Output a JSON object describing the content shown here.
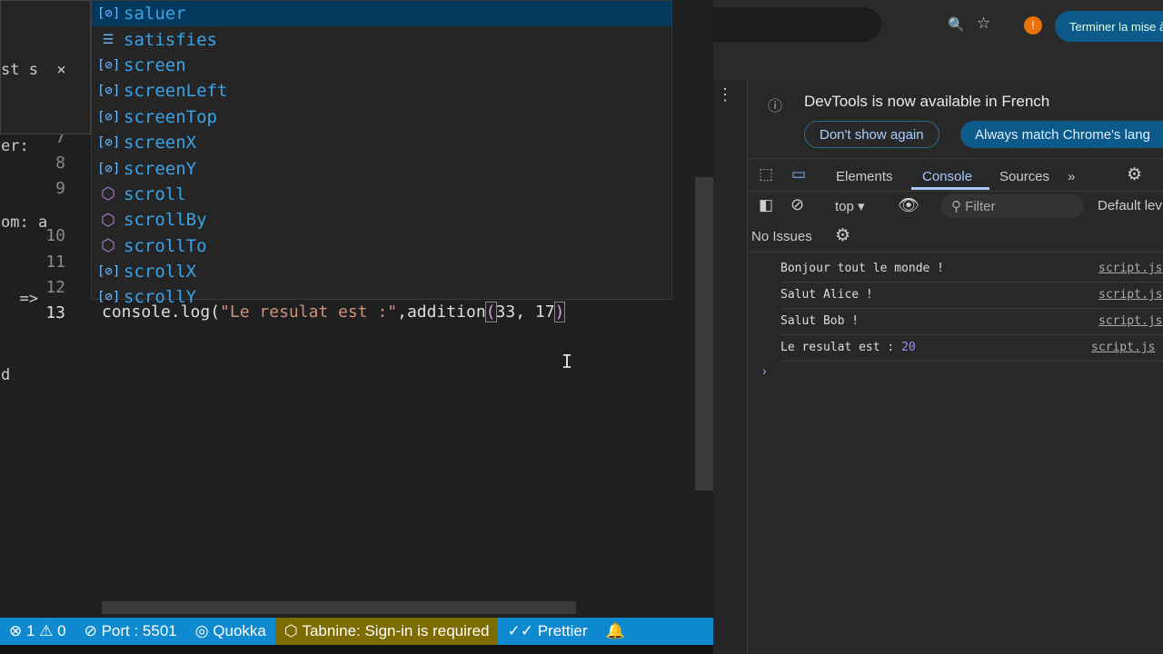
{
  "editor": {
    "tooltip_lines": [
      "st s  ×",
      "er:",
      "om: a",
      "  =>",
      "d"
    ],
    "line_numbers": [
      "7",
      "8",
      "9",
      "10",
      "11",
      "12",
      "13"
    ],
    "code": {
      "prefix": "console.log(",
      "string": "\"Le resulat est :\"",
      "mid": ",addition",
      "open": "(",
      "args": "33, 17",
      "close": ")"
    },
    "suggestions": [
      {
        "icon": "variable-icon",
        "label": "saluer"
      },
      {
        "icon": "keyword-icon",
        "label": "satisfies"
      },
      {
        "icon": "variable-icon",
        "label": "screen"
      },
      {
        "icon": "variable-icon",
        "label": "screenLeft"
      },
      {
        "icon": "variable-icon",
        "label": "screenTop"
      },
      {
        "icon": "variable-icon",
        "label": "screenX"
      },
      {
        "icon": "variable-icon",
        "label": "screenY"
      },
      {
        "icon": "method-icon",
        "label": "scroll"
      },
      {
        "icon": "method-icon",
        "label": "scrollBy"
      },
      {
        "icon": "method-icon",
        "label": "scrollTo"
      },
      {
        "icon": "variable-icon",
        "label": "scrollX"
      },
      {
        "icon": "variable-icon",
        "label": "scrollY"
      }
    ]
  },
  "status": {
    "errors": "1",
    "warnings": "0",
    "port": "Port : 5501",
    "quokka": "Quokka",
    "tabnine": "Tabnine: Sign-in is required",
    "prettier": "Prettier"
  },
  "browser": {
    "update_button": "Terminer la mise à",
    "profile_initial": "!"
  },
  "devtools": {
    "banner": "DevTools is now available in French",
    "dont_show": "Don't show again",
    "always_match": "Always match Chrome's lang",
    "tabs": [
      "Elements",
      "Console",
      "Sources"
    ],
    "context": "top",
    "filter_placeholder": "Filter",
    "levels": "Default lev",
    "issues": "No Issues",
    "logs": [
      {
        "text": "Bonjour tout le monde !",
        "source": "script.js"
      },
      {
        "text": "Salut Alice !",
        "source": "script.js"
      },
      {
        "text": "Salut Bob !",
        "source": "script.js"
      },
      {
        "text": "Le resulat est : ",
        "value": "20",
        "source": "script.js"
      }
    ]
  },
  "colors": {
    "status_bar": "#0f8ad1",
    "tabnine": "#7d6c00",
    "selection": "#04395e",
    "accent": "#0b5a8a"
  }
}
